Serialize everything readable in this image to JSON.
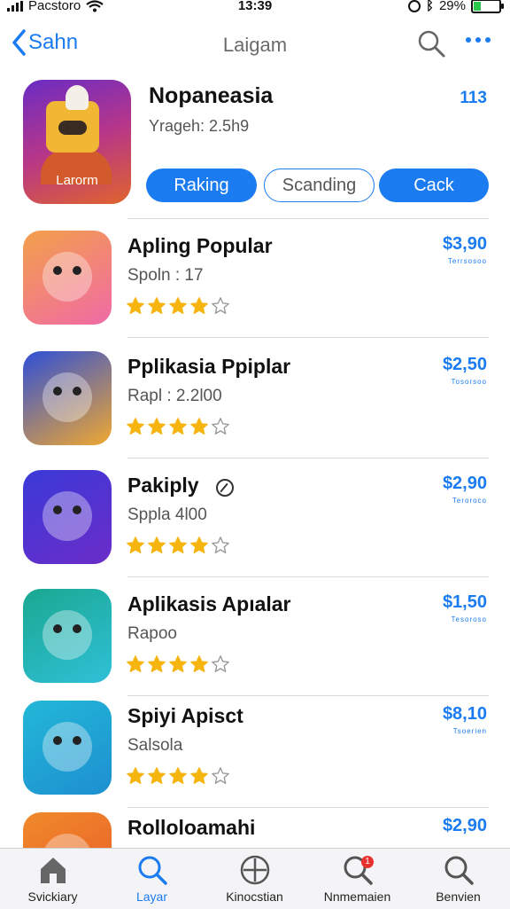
{
  "status_bar": {
    "carrier": "Pacstoro",
    "time": "13:39",
    "battery": "29%",
    "battery_level": 0.29
  },
  "nav": {
    "back_label": "Sahn",
    "title": "Laigam"
  },
  "featured": {
    "name": "Nopaneasia",
    "subtitle": "Yrageh: 2.5h9",
    "count": "113",
    "icon_label": "Larorm",
    "buttons": [
      "Raking",
      "Scanding",
      "Cack"
    ]
  },
  "apps": [
    {
      "name": "Apling Popular",
      "subtitle": "Spoln : 17",
      "rating": 4,
      "price": "$3,90",
      "price_note": "Terrsosoo",
      "colors": [
        "#f3a04a",
        "#f06aa6"
      ]
    },
    {
      "name": "Pplikasia Ppiplar",
      "subtitle": "Rapl : 2.2l00",
      "rating": 4,
      "price": "$2,50",
      "price_note": "Tosorsoo",
      "colors": [
        "#2e4fd8",
        "#f0a830"
      ]
    },
    {
      "name": "Pakiply",
      "subtitle": "Sppla 4l00",
      "rating": 4,
      "price": "$2,90",
      "price_note": "Teroroco",
      "colors": [
        "#3a3ad8",
        "#6b2cc8"
      ]
    },
    {
      "name": "Aplikasis Apıalar",
      "subtitle": "Rapoo",
      "rating": 4,
      "price": "$1,50",
      "price_note": "Tesoroso",
      "colors": [
        "#1aa890",
        "#2fc0d8"
      ]
    },
    {
      "name": "Spiyi Apisct",
      "subtitle": "Salsola",
      "rating": 4,
      "price": "$8,10",
      "price_note": "Tsoerien",
      "colors": [
        "#22b8d8",
        "#1e8fd0"
      ]
    },
    {
      "name": "Rolloloamahi",
      "subtitle": "",
      "rating": 0,
      "price": "$2,90",
      "price_note": "",
      "colors": [
        "#f08a2a",
        "#e85a2a"
      ]
    }
  ],
  "tabs": [
    {
      "label": "Svickiary",
      "icon": "home-icon"
    },
    {
      "label": "Layar",
      "icon": "search-icon"
    },
    {
      "label": "Kinocstian",
      "icon": "compass-icon"
    },
    {
      "label": "Nnmemaien",
      "icon": "search-icon",
      "badge": "1"
    },
    {
      "label": "Benvien",
      "icon": "search-icon"
    }
  ],
  "colors": {
    "accent": "#1a7cf0",
    "star": "#f5b50e",
    "badge": "#e8302f"
  }
}
